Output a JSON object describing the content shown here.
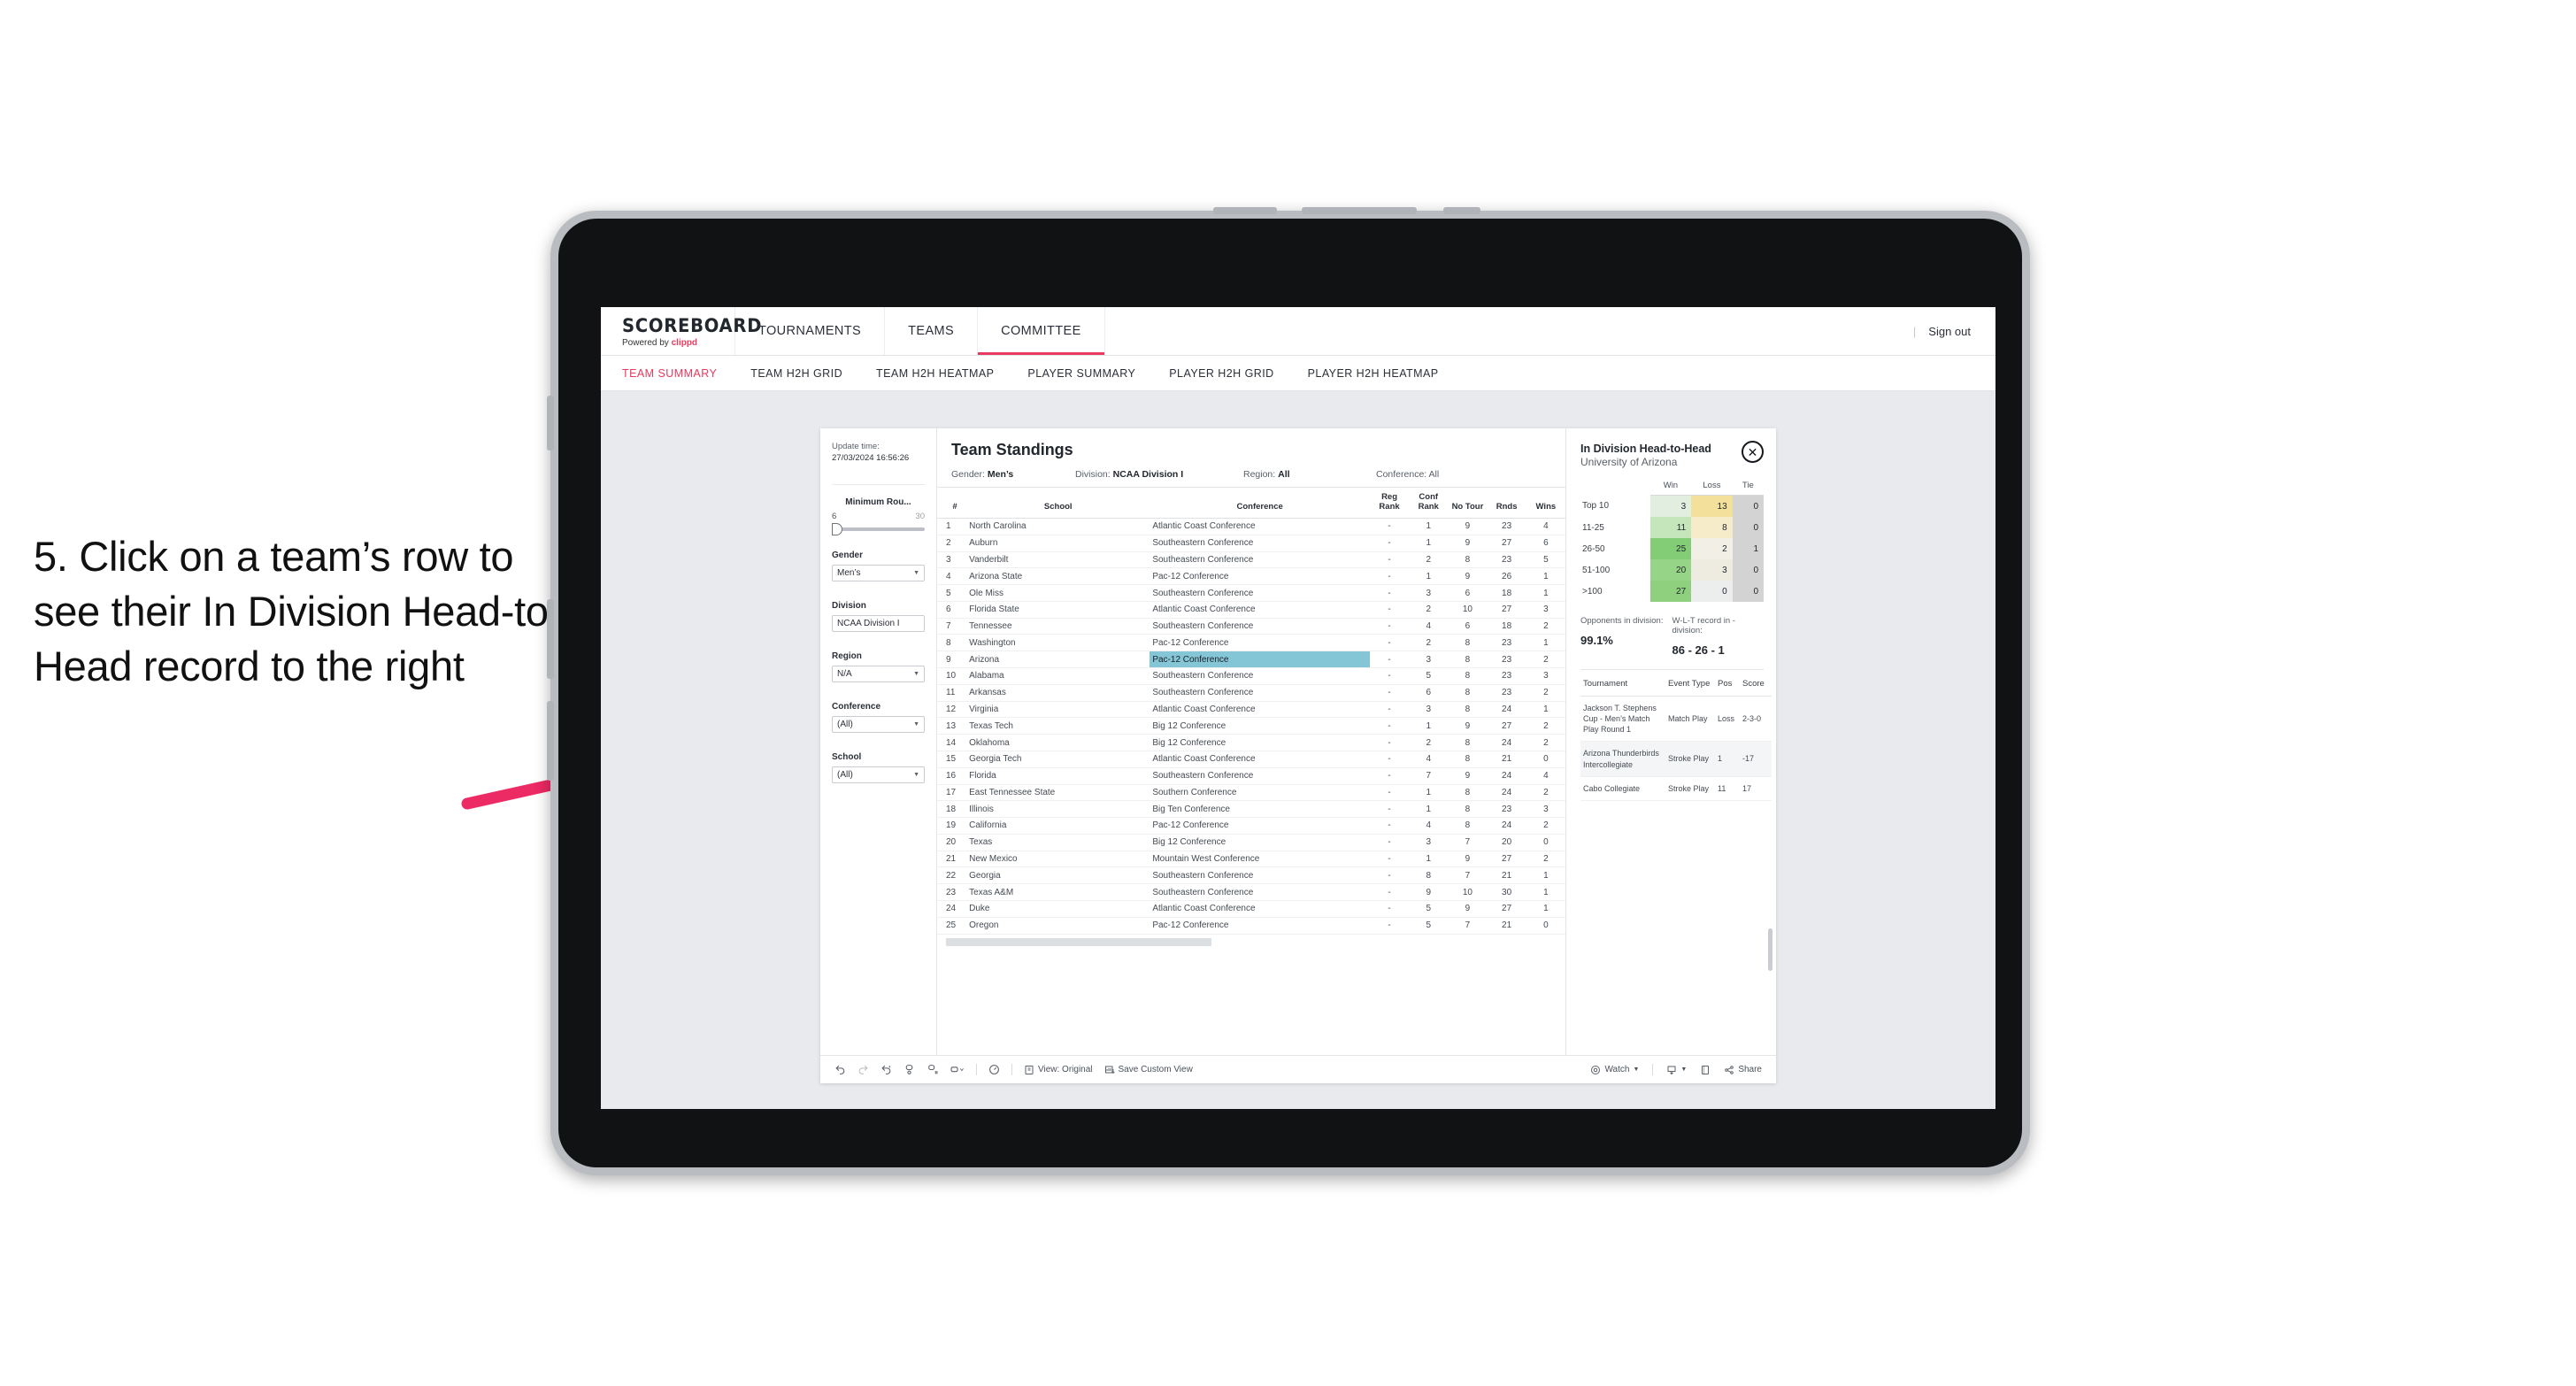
{
  "annotation": {
    "text": "5. Click on a team’s row to see their In Division Head-to-Head record to the right",
    "arrow_color": "#ec2a63"
  },
  "topnav": {
    "brand_title": "SCOREBOARD",
    "brand_sub_prefix": "Powered by ",
    "brand_sub_name": "clippd",
    "items": [
      {
        "label": "TOURNAMENTS",
        "active": false
      },
      {
        "label": "TEAMS",
        "active": false
      },
      {
        "label": "COMMITTEE",
        "active": true
      }
    ],
    "divider": "|",
    "sign_out": "Sign out",
    "accent": "#e8395e"
  },
  "subnav": {
    "items": [
      {
        "label": "TEAM SUMMARY",
        "active": true
      },
      {
        "label": "TEAM H2H GRID",
        "active": false
      },
      {
        "label": "TEAM H2H HEATMAP",
        "active": false
      },
      {
        "label": "PLAYER SUMMARY",
        "active": false
      },
      {
        "label": "PLAYER H2H GRID",
        "active": false
      },
      {
        "label": "PLAYER H2H HEATMAP",
        "active": false
      }
    ]
  },
  "filters": {
    "update_label": "Update time:",
    "update_value": "27/03/2024 16:56:26",
    "slider": {
      "title": "Minimum Rou...",
      "min": "6",
      "max": "30"
    },
    "selects": [
      {
        "title": "Gender",
        "value": "Men’s"
      },
      {
        "title": "Division",
        "value": "NCAA Division I"
      },
      {
        "title": "Region",
        "value": "N/A"
      },
      {
        "title": "Conference",
        "value": "(All)"
      },
      {
        "title": "School",
        "value": "(All)"
      }
    ]
  },
  "standings": {
    "title": "Team Standings",
    "meta": [
      {
        "label": "Gender:",
        "value": "Men’s"
      },
      {
        "label": "Division:",
        "value": "NCAA Division I"
      },
      {
        "label": "Region:",
        "value": "All"
      },
      {
        "label": "Conference:",
        "value": "All"
      }
    ],
    "columns": [
      "#",
      "School",
      "Conference",
      "Reg Rank",
      "Conf Rank",
      "No Tour",
      "Rnds",
      "Wins"
    ],
    "selected_row": 9,
    "rows": [
      {
        "rank": "1",
        "school": "North Carolina",
        "conference": "Atlantic Coast Conference",
        "reg_rank": "-",
        "conf_rank": "1",
        "no_tour": "9",
        "rnds": "23",
        "wins": "4"
      },
      {
        "rank": "2",
        "school": "Auburn",
        "conference": "Southeastern Conference",
        "reg_rank": "-",
        "conf_rank": "1",
        "no_tour": "9",
        "rnds": "27",
        "wins": "6"
      },
      {
        "rank": "3",
        "school": "Vanderbilt",
        "conference": "Southeastern Conference",
        "reg_rank": "-",
        "conf_rank": "2",
        "no_tour": "8",
        "rnds": "23",
        "wins": "5"
      },
      {
        "rank": "4",
        "school": "Arizona State",
        "conference": "Pac-12 Conference",
        "reg_rank": "-",
        "conf_rank": "1",
        "no_tour": "9",
        "rnds": "26",
        "wins": "1"
      },
      {
        "rank": "5",
        "school": "Ole Miss",
        "conference": "Southeastern Conference",
        "reg_rank": "-",
        "conf_rank": "3",
        "no_tour": "6",
        "rnds": "18",
        "wins": "1"
      },
      {
        "rank": "6",
        "school": "Florida State",
        "conference": "Atlantic Coast Conference",
        "reg_rank": "-",
        "conf_rank": "2",
        "no_tour": "10",
        "rnds": "27",
        "wins": "3"
      },
      {
        "rank": "7",
        "school": "Tennessee",
        "conference": "Southeastern Conference",
        "reg_rank": "-",
        "conf_rank": "4",
        "no_tour": "6",
        "rnds": "18",
        "wins": "2"
      },
      {
        "rank": "8",
        "school": "Washington",
        "conference": "Pac-12 Conference",
        "reg_rank": "-",
        "conf_rank": "2",
        "no_tour": "8",
        "rnds": "23",
        "wins": "1"
      },
      {
        "rank": "9",
        "school": "Arizona",
        "conference": "Pac-12 Conference",
        "reg_rank": "-",
        "conf_rank": "3",
        "no_tour": "8",
        "rnds": "23",
        "wins": "2"
      },
      {
        "rank": "10",
        "school": "Alabama",
        "conference": "Southeastern Conference",
        "reg_rank": "-",
        "conf_rank": "5",
        "no_tour": "8",
        "rnds": "23",
        "wins": "3"
      },
      {
        "rank": "11",
        "school": "Arkansas",
        "conference": "Southeastern Conference",
        "reg_rank": "-",
        "conf_rank": "6",
        "no_tour": "8",
        "rnds": "23",
        "wins": "2"
      },
      {
        "rank": "12",
        "school": "Virginia",
        "conference": "Atlantic Coast Conference",
        "reg_rank": "-",
        "conf_rank": "3",
        "no_tour": "8",
        "rnds": "24",
        "wins": "1"
      },
      {
        "rank": "13",
        "school": "Texas Tech",
        "conference": "Big 12 Conference",
        "reg_rank": "-",
        "conf_rank": "1",
        "no_tour": "9",
        "rnds": "27",
        "wins": "2"
      },
      {
        "rank": "14",
        "school": "Oklahoma",
        "conference": "Big 12 Conference",
        "reg_rank": "-",
        "conf_rank": "2",
        "no_tour": "8",
        "rnds": "24",
        "wins": "2"
      },
      {
        "rank": "15",
        "school": "Georgia Tech",
        "conference": "Atlantic Coast Conference",
        "reg_rank": "-",
        "conf_rank": "4",
        "no_tour": "8",
        "rnds": "21",
        "wins": "0"
      },
      {
        "rank": "16",
        "school": "Florida",
        "conference": "Southeastern Conference",
        "reg_rank": "-",
        "conf_rank": "7",
        "no_tour": "9",
        "rnds": "24",
        "wins": "4"
      },
      {
        "rank": "17",
        "school": "East Tennessee State",
        "conference": "Southern Conference",
        "reg_rank": "-",
        "conf_rank": "1",
        "no_tour": "8",
        "rnds": "24",
        "wins": "2"
      },
      {
        "rank": "18",
        "school": "Illinois",
        "conference": "Big Ten Conference",
        "reg_rank": "-",
        "conf_rank": "1",
        "no_tour": "8",
        "rnds": "23",
        "wins": "3"
      },
      {
        "rank": "19",
        "school": "California",
        "conference": "Pac-12 Conference",
        "reg_rank": "-",
        "conf_rank": "4",
        "no_tour": "8",
        "rnds": "24",
        "wins": "2"
      },
      {
        "rank": "20",
        "school": "Texas",
        "conference": "Big 12 Conference",
        "reg_rank": "-",
        "conf_rank": "3",
        "no_tour": "7",
        "rnds": "20",
        "wins": "0"
      },
      {
        "rank": "21",
        "school": "New Mexico",
        "conference": "Mountain West Conference",
        "reg_rank": "-",
        "conf_rank": "1",
        "no_tour": "9",
        "rnds": "27",
        "wins": "2"
      },
      {
        "rank": "22",
        "school": "Georgia",
        "conference": "Southeastern Conference",
        "reg_rank": "-",
        "conf_rank": "8",
        "no_tour": "7",
        "rnds": "21",
        "wins": "1"
      },
      {
        "rank": "23",
        "school": "Texas A&M",
        "conference": "Southeastern Conference",
        "reg_rank": "-",
        "conf_rank": "9",
        "no_tour": "10",
        "rnds": "30",
        "wins": "1"
      },
      {
        "rank": "24",
        "school": "Duke",
        "conference": "Atlantic Coast Conference",
        "reg_rank": "-",
        "conf_rank": "5",
        "no_tour": "9",
        "rnds": "27",
        "wins": "1"
      },
      {
        "rank": "25",
        "school": "Oregon",
        "conference": "Pac-12 Conference",
        "reg_rank": "-",
        "conf_rank": "5",
        "no_tour": "7",
        "rnds": "21",
        "wins": "0"
      }
    ]
  },
  "h2h": {
    "title": "In Division Head-to-Head",
    "subtitle": "University of Arizona",
    "close_icon": "✕",
    "columns": [
      "Win",
      "Loss",
      "Tie"
    ],
    "rows": [
      {
        "label": "Top 10",
        "win": "3",
        "loss": "13",
        "tie": "0",
        "win_color": "#e2eedf",
        "loss_color": "#f3e09a",
        "tie_color": "#d3d3d3"
      },
      {
        "label": "11-25",
        "win": "11",
        "loss": "8",
        "tie": "0",
        "win_color": "#c5e5ba",
        "loss_color": "#f6ecca",
        "tie_color": "#d3d3d3"
      },
      {
        "label": "26-50",
        "win": "25",
        "loss": "2",
        "tie": "1",
        "win_color": "#82cd76",
        "loss_color": "#f1efe6",
        "tie_color": "#d3d3d3"
      },
      {
        "label": "51-100",
        "win": "20",
        "loss": "3",
        "tie": "0",
        "win_color": "#96d487",
        "loss_color": "#eeebe0",
        "tie_color": "#d3d3d3"
      },
      {
        "label": ">100",
        "win": "27",
        "loss": "0",
        "tie": "0",
        "win_color": "#8ed07e",
        "loss_color": "#eceded",
        "tie_color": "#d3d3d3"
      }
    ],
    "summary": [
      {
        "label": "Opponents in division:",
        "value": "99.1%"
      },
      {
        "label": "W-L-T record in -division:",
        "value": "86 - 26 - 1"
      }
    ],
    "tournament_columns": [
      "Tournament",
      "Event Type",
      "Pos",
      "Score"
    ],
    "tournaments": [
      {
        "name": "Jackson T. Stephens Cup - Men’s Match Play Round 1",
        "event_type": "Match Play",
        "pos": "Loss",
        "score": "2-3-0"
      },
      {
        "name": "Arizona Thunderbirds Intercollegiate",
        "event_type": "Stroke Play",
        "pos": "1",
        "score": "-17"
      },
      {
        "name": "Cabo Collegiate",
        "event_type": "Stroke Play",
        "pos": "11",
        "score": "17"
      }
    ]
  },
  "toolbar": {
    "left_items": [
      {
        "name": "undo-icon",
        "label": ""
      },
      {
        "name": "redo-icon",
        "label": ""
      },
      {
        "name": "revert-icon",
        "label": ""
      },
      {
        "name": "refresh-icon",
        "label": ""
      },
      {
        "name": "pause-icon",
        "label": ""
      },
      {
        "name": "highlight-icon",
        "label": ""
      }
    ],
    "mid_items": [
      {
        "name": "fit-icon",
        "label": ""
      },
      {
        "name": "view-original",
        "label": "View: Original"
      },
      {
        "name": "save-custom-view",
        "label": "Save Custom View"
      }
    ],
    "right_items": [
      {
        "name": "watch-button",
        "label": "Watch"
      },
      {
        "name": "download-button",
        "label": ""
      },
      {
        "name": "fullscreen-button",
        "label": ""
      },
      {
        "name": "share-button",
        "label": "Share"
      }
    ]
  }
}
